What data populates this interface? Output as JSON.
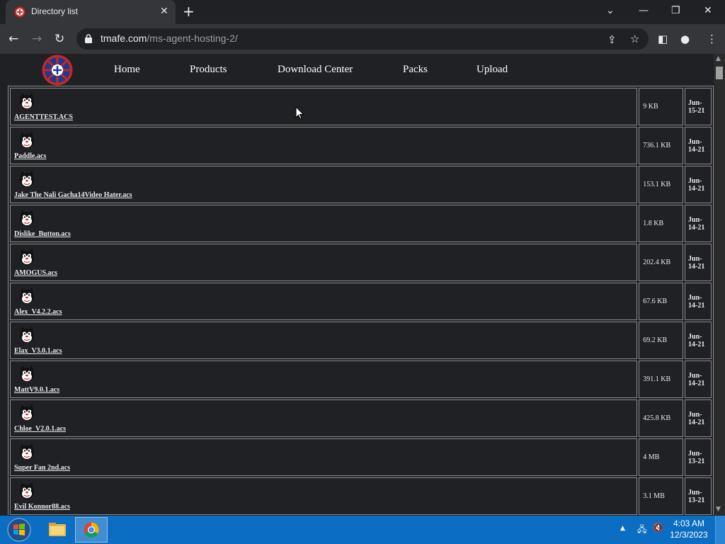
{
  "browser": {
    "tab_title": "Directory list",
    "tab_close": "✕",
    "new_tab": "+",
    "url_domain": "tmafe.com",
    "url_path": "/ms-agent-hosting-2/"
  },
  "nav": {
    "links": [
      "Home",
      "Products",
      "Download Center",
      "Packs",
      "Upload"
    ]
  },
  "files": [
    {
      "name": "AGENTTEST.ACS",
      "size": "9 KB",
      "date": "Jun-15-21"
    },
    {
      "name": "Paddle.acs",
      "size": "736.1 KB",
      "date": "Jun-14-21"
    },
    {
      "name": "Jake The Nali Gacha14Video Hater.acs",
      "size": "153.1 KB",
      "date": "Jun-14-21"
    },
    {
      "name": "Dislike_Button.acs",
      "size": "1.8 KB",
      "date": "Jun-14-21"
    },
    {
      "name": "AMOGUS.acs",
      "size": "202.4 KB",
      "date": "Jun-14-21"
    },
    {
      "name": "Alex_V4.2.2.acs",
      "size": "67.6 KB",
      "date": "Jun-14-21"
    },
    {
      "name": "Elax_V3.0.1.acs",
      "size": "69.2 KB",
      "date": "Jun-14-21"
    },
    {
      "name": "MattV9.0.1.acs",
      "size": "391.1 KB",
      "date": "Jun-14-21"
    },
    {
      "name": "Chloe_V2.0.1.acs",
      "size": "425.8 KB",
      "date": "Jun-14-21"
    },
    {
      "name": "Super Fan 2nd.acs",
      "size": "4 MB",
      "date": "Jun-13-21"
    },
    {
      "name": "Evil Konnor88.acs",
      "size": "3.1 MB",
      "date": "Jun-13-21"
    }
  ],
  "taskbar": {
    "time": "4:03 AM",
    "date": "12/3/2023"
  }
}
